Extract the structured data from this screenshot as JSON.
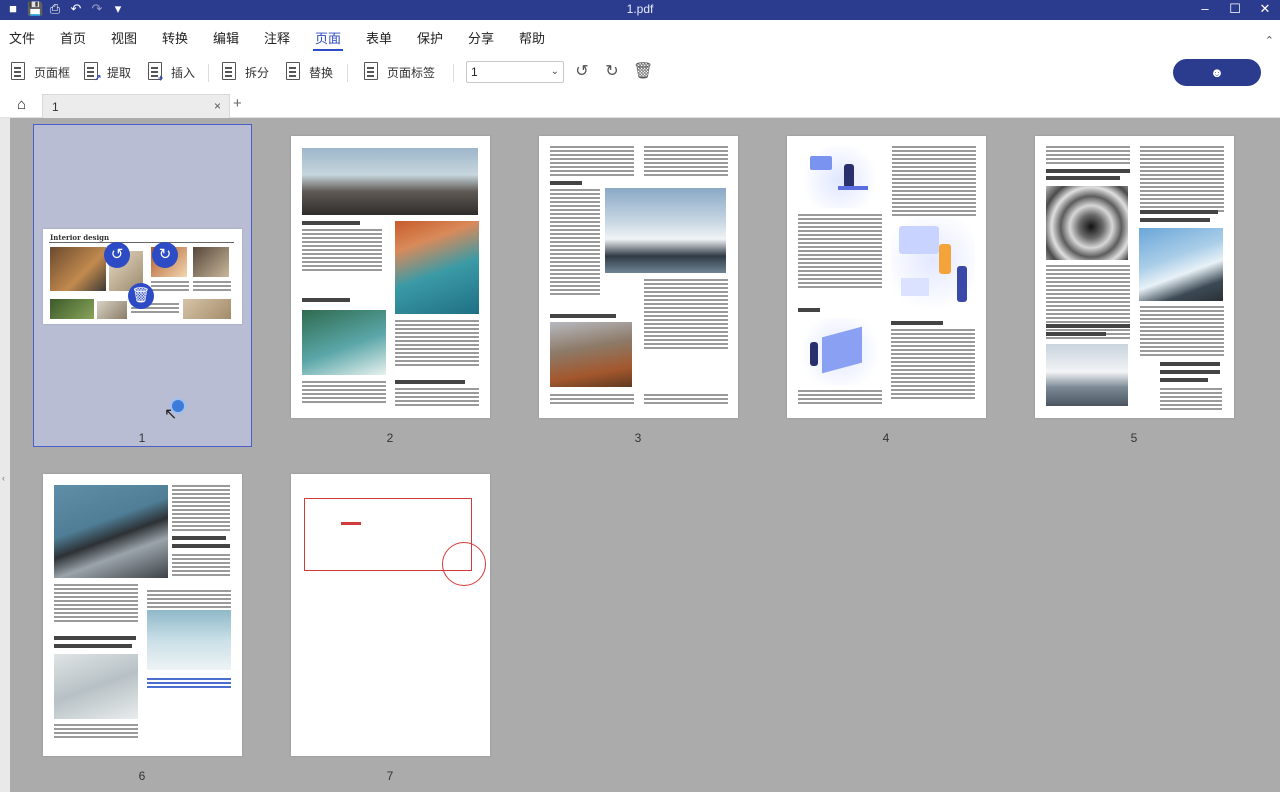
{
  "titlebar": {
    "filename": "1.pdf"
  },
  "menu": {
    "items": [
      {
        "label": "文件"
      },
      {
        "label": "首页"
      },
      {
        "label": "视图"
      },
      {
        "label": "转换"
      },
      {
        "label": "编辑"
      },
      {
        "label": "注释"
      },
      {
        "label": "页面"
      },
      {
        "label": "表单"
      },
      {
        "label": "保护"
      },
      {
        "label": "分享"
      },
      {
        "label": "帮助"
      }
    ],
    "active": "页面"
  },
  "toolbar": {
    "page_box": "页面框",
    "extract": "提取",
    "insert": "插入",
    "split": "拆分",
    "replace": "替换",
    "page_label": "页面标签",
    "page_select_value": "1"
  },
  "tabs": {
    "doc_tab": "1"
  },
  "pages": {
    "n1": "1",
    "n2": "2",
    "n3": "3",
    "n4": "4",
    "n5": "5",
    "n6": "6",
    "n7": "7"
  },
  "page1": {
    "heading": "Interior design"
  },
  "colors": {
    "brand": "#2b3c8f",
    "accent": "#2d4bc4",
    "stamp_red": "#d23b3b"
  }
}
